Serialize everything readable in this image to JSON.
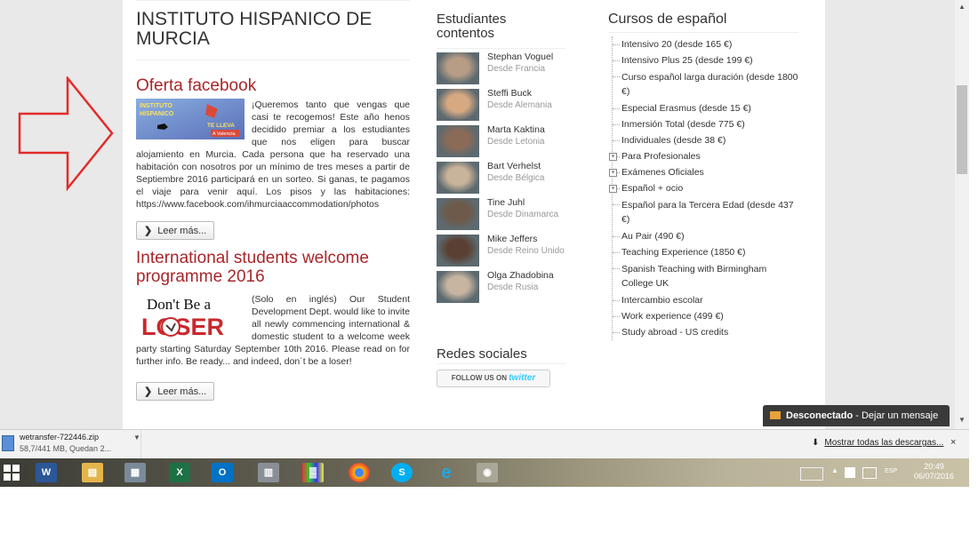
{
  "site": {
    "title": "INSTITUTO HISPANICO DE MURCIA"
  },
  "posts": [
    {
      "title": "Oferta facebook",
      "image_text": {
        "line1": "INSTITUTO",
        "line2": "HISPANICO",
        "line3": "TE LLEVA",
        "line4": "A Valencia"
      },
      "body": "¡Queremos tanto que vengas que casi te recogemos! Este año henos decidido premiar a los estudiantes que nos eligen para buscar alojamiento en Murcia. Cada persona que ha reservado una habitación con nosotros por un mínimo de tres meses a partir de Septiembre 2016 participará en un sorteo. Si ganas, te pagamos el viaje para venir aquí. Los pisos y las habitaciones: https://www.facebook.com/ihmurciaaccommodation/photos",
      "read_more": "Leer más..."
    },
    {
      "title": "International students welcome programme 2016",
      "image_text": {
        "line1": "Don't Be a",
        "line2": "LOSER"
      },
      "body": "(Solo en inglés) Our Student Development Dept. would like to invite all newly commencing international & domestic student to a welcome week party starting Saturday September 10th 2016. Please read on for further info. Be ready... and indeed, don´t be a loser!",
      "read_more": "Leer más..."
    }
  ],
  "students": {
    "title": "Estudiantes contentos",
    "items": [
      {
        "name": "Stephan Voguel",
        "from": "Desde Francia"
      },
      {
        "name": "Steffi Buck",
        "from": "Desde Alemania"
      },
      {
        "name": "Marta Kaktina",
        "from": "Desde Letonia"
      },
      {
        "name": "Bart Verhelst",
        "from": "Desde Bélgica"
      },
      {
        "name": "Tine Juhl",
        "from": "Desde Dinamarca"
      },
      {
        "name": "Mike Jeffers",
        "from": "Desde Reino Unido"
      },
      {
        "name": "Olga Zhadobina",
        "from": "Desde Rusia"
      }
    ]
  },
  "social": {
    "title": "Redes sociales",
    "follow_prefix": "FOLLOW US ON",
    "follow_brand": "twitter"
  },
  "courses": {
    "title": "Cursos de español",
    "items": [
      {
        "label": "Intensivo 20 (desde 165 €)",
        "expandable": false
      },
      {
        "label": "Intensivo Plus 25 (desde 199 €)",
        "expandable": false
      },
      {
        "label": "Curso español larga duración (desde 1800 €)",
        "expandable": false
      },
      {
        "label": "Especial Erasmus (desde 15 €)",
        "expandable": false
      },
      {
        "label": "Inmersión Total (desde 775 €)",
        "expandable": false
      },
      {
        "label": "Individuales (desde 38 €)",
        "expandable": false
      },
      {
        "label": "Para Profesionales",
        "expandable": true
      },
      {
        "label": "Exámenes Oficiales",
        "expandable": true
      },
      {
        "label": "Español + ocio",
        "expandable": true
      },
      {
        "label": "Español para la Tercera Edad (desde 437 €)",
        "expandable": false
      },
      {
        "label": "Au Pair (490 €)",
        "expandable": false
      },
      {
        "label": "Teaching Experience (1850 €)",
        "expandable": false
      },
      {
        "label": "Spanish Teaching with Birmingham College UK",
        "expandable": false
      },
      {
        "label": "Intercambio escolar",
        "expandable": false
      },
      {
        "label": "Work experience (499 €)",
        "expandable": false
      },
      {
        "label": "Study abroad - US credits",
        "expandable": false
      }
    ]
  },
  "chat": {
    "status": "Desconectado",
    "action": " - Dejar un mensaje"
  },
  "downloads": {
    "file": "wetransfer-722446.zip",
    "status": "58,7/441 MB, Quedan 2...",
    "show_all": "Mostrar todas las descargas...",
    "close": "×"
  },
  "taskbar": {
    "apps": [
      "word-icon",
      "explorer-icon",
      "file-manager-icon",
      "excel-icon",
      "outlook-icon",
      "calculator-icon",
      "app-grid-icon",
      "chrome-icon",
      "skype-icon",
      "ie-icon",
      "chrome-active-icon"
    ],
    "lang": "ESP",
    "time": "20:49",
    "date": "06/07/2016"
  },
  "colors": {
    "accent_red": "#a8262a",
    "twitter_blue": "#33ccff",
    "chat_bg": "#3a3a3a"
  }
}
